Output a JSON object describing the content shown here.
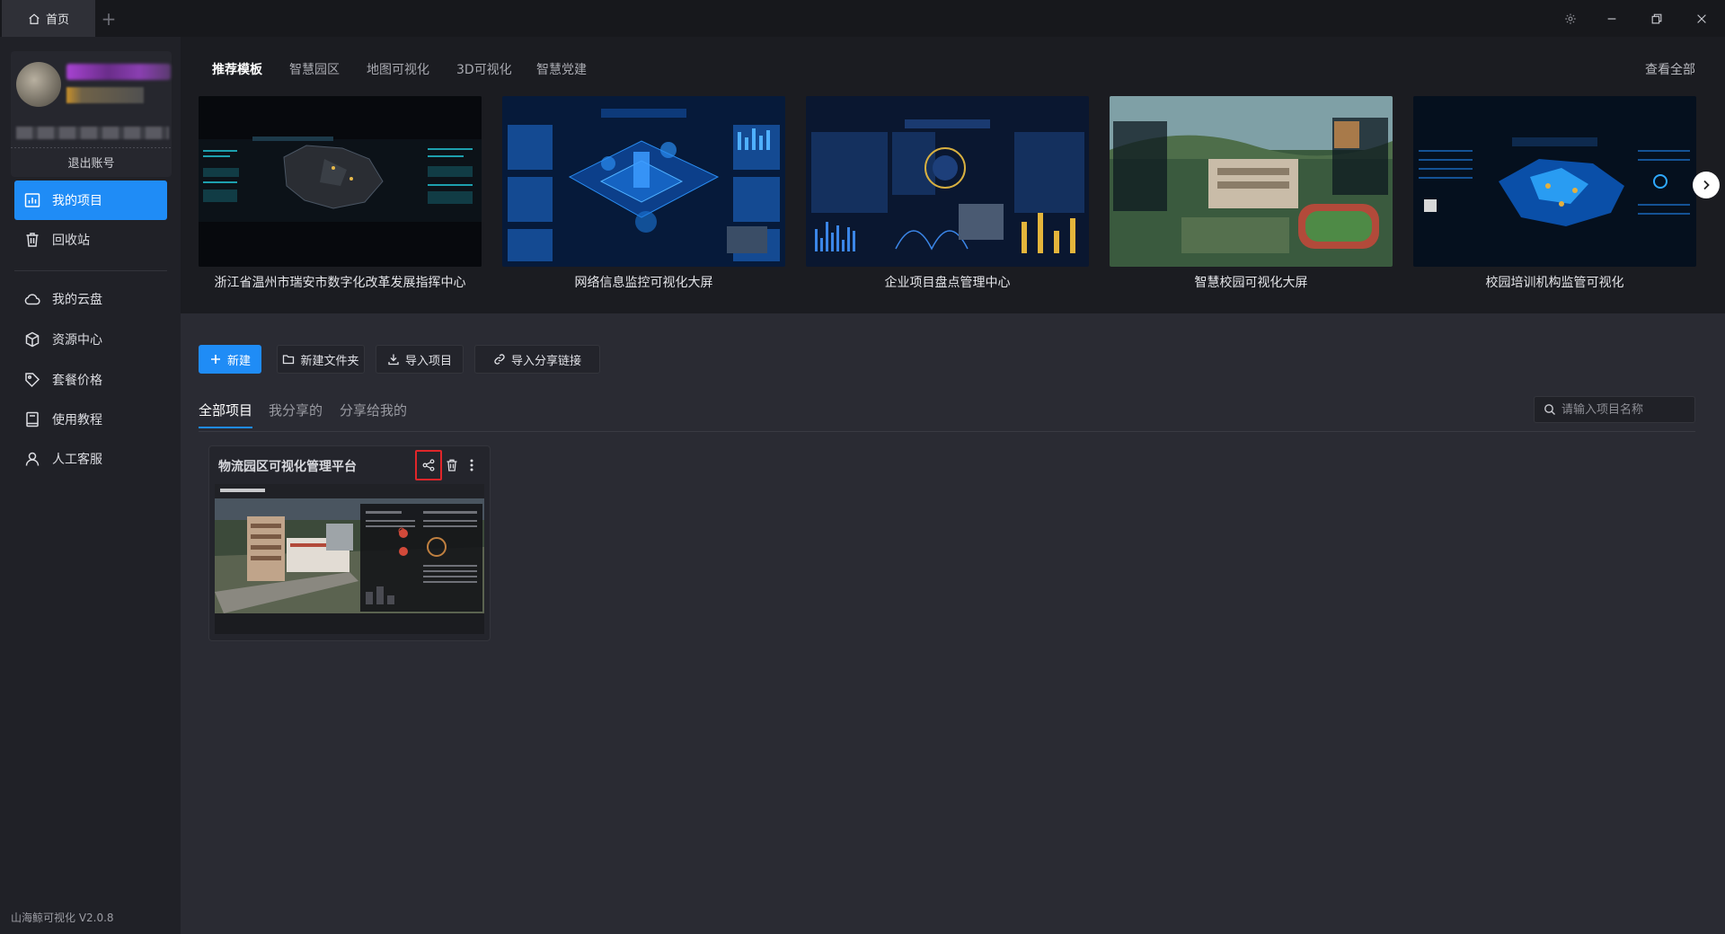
{
  "titlebar": {
    "home_tab": "首页",
    "add_tab": "+"
  },
  "sidebar": {
    "logout": "退出账号",
    "items": [
      {
        "label": "我的项目",
        "icon": "chart-bar-icon",
        "active": true
      },
      {
        "label": "回收站",
        "icon": "trash-icon"
      },
      {
        "label": "我的云盘",
        "icon": "cloud-icon"
      },
      {
        "label": "资源中心",
        "icon": "cube-icon"
      },
      {
        "label": "套餐价格",
        "icon": "tag-icon"
      },
      {
        "label": "使用教程",
        "icon": "book-icon"
      },
      {
        "label": "人工客服",
        "icon": "user-icon"
      }
    ],
    "version": "山海鲸可视化 V2.0.8"
  },
  "templates": {
    "tabs": [
      "推荐模板",
      "智慧园区",
      "地图可视化",
      "3D可视化",
      "智慧党建"
    ],
    "active_tab": "推荐模板",
    "view_all": "查看全部",
    "cards": [
      {
        "title": "浙江省温州市瑞安市数字化改革发展指挥中心"
      },
      {
        "title": "网络信息监控可视化大屏"
      },
      {
        "title": "企业项目盘点管理中心"
      },
      {
        "title": "智慧校园可视化大屏"
      },
      {
        "title": "校园培训机构监管可视化"
      }
    ]
  },
  "toolbar": {
    "new": "新建",
    "new_folder": "新建文件夹",
    "import_project": "导入项目",
    "import_share_link": "导入分享链接"
  },
  "project_tabs": {
    "all": "全部项目",
    "my_shared": "我分享的",
    "shared_to_me": "分享给我的"
  },
  "search": {
    "placeholder": "请输入项目名称"
  },
  "projects": [
    {
      "title": "物流园区可视化管理平台"
    }
  ],
  "colors": {
    "accent": "#1f8cf6",
    "highlight_border": "#e0262a"
  }
}
